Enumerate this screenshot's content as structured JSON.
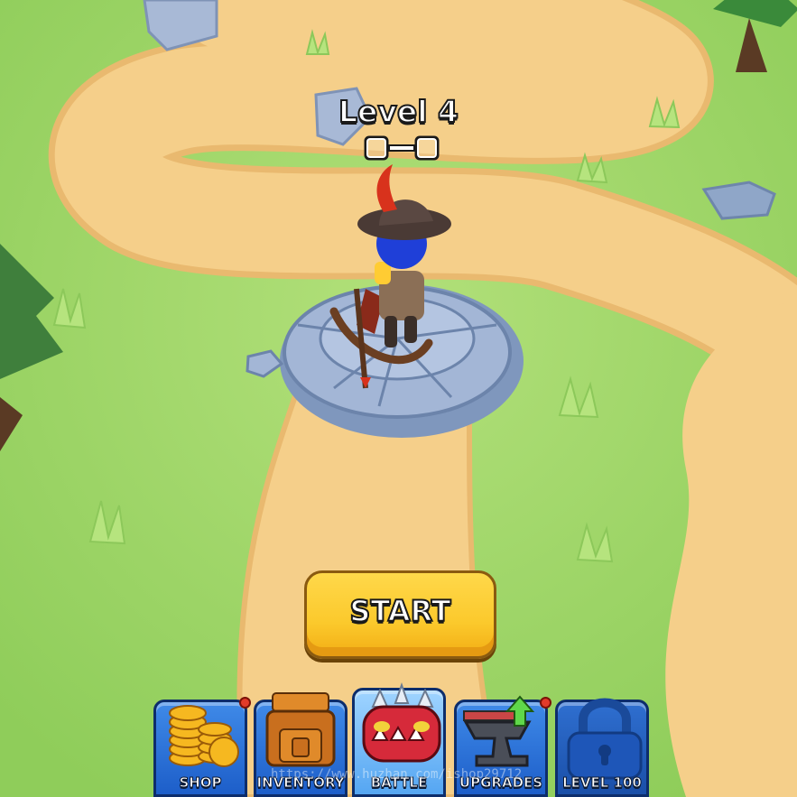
{
  "level": {
    "title": "Level 4",
    "progress_filled": 0,
    "progress_total": 2
  },
  "start_button": {
    "label": "START"
  },
  "nav": {
    "tabs": [
      {
        "label": "SHOP",
        "icon": "coins-icon",
        "notification": true,
        "active": false
      },
      {
        "label": "INVENTORY",
        "icon": "backpack-icon",
        "notification": false,
        "active": false
      },
      {
        "label": "BATTLE",
        "icon": "monster-icon",
        "notification": false,
        "active": true
      },
      {
        "label": "UPGRADES",
        "icon": "anvil-upgrade-icon",
        "notification": true,
        "active": false
      },
      {
        "label": "LEVEL 100",
        "icon": "lock-icon",
        "notification": false,
        "active": false,
        "locked": true
      }
    ]
  },
  "watermark": "https://www.huzhan.com/ishop29712",
  "colors": {
    "grass": "#9fd86a",
    "path": "#f5cf8a",
    "stone": "#8fa6c8",
    "start": "#fbc92c",
    "nav_blue": "#2f76dc"
  }
}
